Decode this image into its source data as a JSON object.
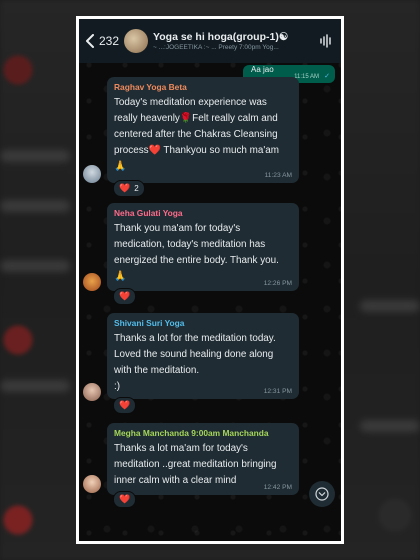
{
  "header": {
    "back_count": "232",
    "title": "Yoga se hi hoga(group-1)☯",
    "subtitle": "~ ...:JOGEETIKA :~ ... Preety 7:00pm Yog..."
  },
  "outgoing": {
    "text": "Aa jao",
    "time": "11:15 AM",
    "tick": "✓"
  },
  "messages": [
    {
      "sender": "Raghav Yoga Beta",
      "sender_color": "#f08a5d",
      "text": "Today's meditation experience was really heavenly🌹Felt really calm and centered after the Chakras Cleansing process❤️ Thankyou so much ma'am",
      "emoji_line": "🙏",
      "time": "11:23 AM",
      "reaction": "❤️",
      "reaction_count": "2"
    },
    {
      "sender": "Neha Gulati Yoga",
      "sender_color": "#ff6b8a",
      "text": "Thank you ma'am for today's medication, today's meditation has energized the entire body. Thank you.",
      "emoji_line": "🙏",
      "time": "12:26 PM",
      "reaction": "❤️",
      "reaction_count": ""
    },
    {
      "sender": "Shivani Suri Yoga",
      "sender_color": "#53bdeb",
      "text": "Thanks a lot for the meditation today. Loved the sound healing done along with the meditation.",
      "emoji_line": ":)",
      "time": "12:31 PM",
      "reaction": "❤️",
      "reaction_count": ""
    },
    {
      "sender": "Megha Manchanda 9:00am Manchanda",
      "sender_color": "#a5d65a",
      "text": "Thanks a lot ma'am for today's meditation ..great meditation bringing inner calm with a clear mind",
      "emoji_line": "",
      "time": "12:42 PM",
      "reaction": "❤️",
      "reaction_count": ""
    }
  ],
  "icons": {
    "back": "chevron-left-icon",
    "voice": "waveform-icon",
    "scroll": "chevron-down-circle-icon"
  }
}
